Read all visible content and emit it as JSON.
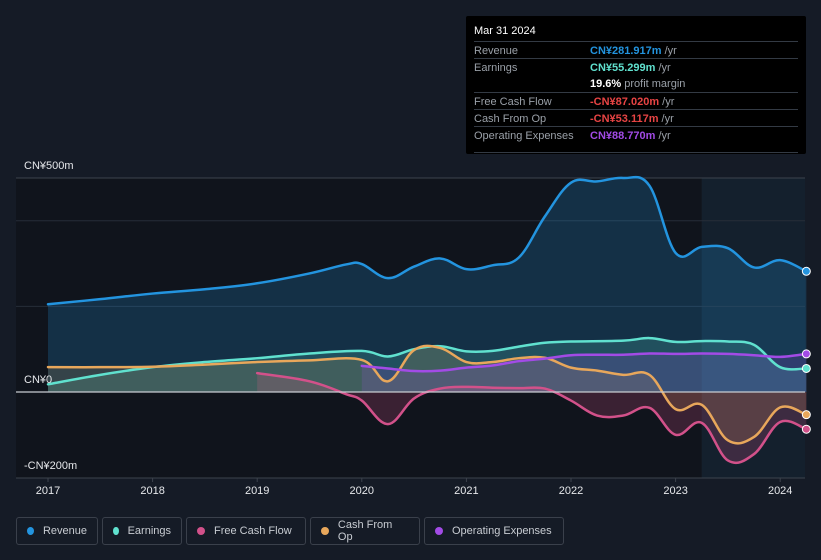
{
  "tooltip": {
    "date": "Mar 31 2024",
    "rows": [
      {
        "label": "Revenue",
        "value": "CN¥281.917m",
        "unit": " /yr",
        "color": "#2394df"
      },
      {
        "label": "Earnings",
        "value": "CN¥55.299m",
        "unit": " /yr",
        "color": "#60e1cf"
      },
      {
        "label": "",
        "value": "19.6%",
        "unit": " profit margin",
        "color": "#ffffff"
      },
      {
        "label": "Free Cash Flow",
        "value": "-CN¥87.020m",
        "unit": " /yr",
        "color": "#e84444"
      },
      {
        "label": "Cash From Op",
        "value": "-CN¥53.117m",
        "unit": " /yr",
        "color": "#e84444"
      },
      {
        "label": "Operating Expenses",
        "value": "CN¥88.770m",
        "unit": " /yr",
        "color": "#a24be6"
      }
    ]
  },
  "chart_data": {
    "type": "area",
    "title": "",
    "xlabel": "",
    "ylabel": "",
    "y_tick_labels": [
      "CN¥500m",
      "CN¥0",
      "-CN¥200m"
    ],
    "x_tick_labels": [
      "2017",
      "2018",
      "2019",
      "2020",
      "2021",
      "2022",
      "2023",
      "2024"
    ],
    "ylim": [
      -200,
      500
    ],
    "xlim": [
      2016.7,
      2024.25
    ],
    "grid": true,
    "legend_position": "bottom-left",
    "highlight_start": 2023.25,
    "series": [
      {
        "name": "Revenue",
        "color": "#2394df",
        "x": [
          2017.0,
          2017.5,
          2018.0,
          2018.5,
          2019.0,
          2019.5,
          2019.85,
          2020.0,
          2020.25,
          2020.5,
          2020.75,
          2021.0,
          2021.25,
          2021.5,
          2021.75,
          2022.0,
          2022.25,
          2022.5,
          2022.75,
          2023.0,
          2023.25,
          2023.5,
          2023.75,
          2024.0,
          2024.25
        ],
        "values": [
          205,
          217,
          230,
          240,
          254,
          277,
          298,
          299,
          266,
          293,
          312,
          287,
          296,
          314,
          410,
          489,
          492,
          500,
          482,
          325,
          339,
          336,
          291,
          308,
          282
        ]
      },
      {
        "name": "Earnings",
        "color": "#60e1cf",
        "x": [
          2017.0,
          2017.5,
          2018.0,
          2018.5,
          2019.0,
          2019.5,
          2020.0,
          2020.25,
          2020.5,
          2020.75,
          2021.0,
          2021.25,
          2021.5,
          2021.75,
          2022.0,
          2022.5,
          2022.75,
          2023.0,
          2023.25,
          2023.5,
          2023.75,
          2024.0,
          2024.25
        ],
        "values": [
          18,
          40,
          58,
          70,
          79,
          90,
          96,
          83,
          100,
          107,
          95,
          96,
          106,
          115,
          118,
          120,
          126,
          117,
          119,
          118,
          110,
          58,
          55
        ]
      },
      {
        "name": "Free Cash Flow",
        "color": "#d2518a",
        "x": [
          2019.0,
          2019.5,
          2019.85,
          2020.0,
          2020.25,
          2020.5,
          2020.75,
          2021.0,
          2021.25,
          2021.5,
          2021.75,
          2022.0,
          2022.25,
          2022.5,
          2022.75,
          2023.0,
          2023.25,
          2023.5,
          2023.75,
          2024.0,
          2024.25
        ],
        "values": [
          44,
          25,
          -5,
          -20,
          -75,
          -15,
          8,
          12,
          10,
          9,
          8,
          -20,
          -55,
          -55,
          -37,
          -100,
          -72,
          -160,
          -145,
          -70,
          -87
        ]
      },
      {
        "name": "Cash From Op",
        "color": "#e8a75b",
        "x": [
          2017.0,
          2017.5,
          2018.0,
          2018.5,
          2019.0,
          2019.5,
          2020.0,
          2020.25,
          2020.5,
          2020.75,
          2021.0,
          2021.25,
          2021.5,
          2021.75,
          2022.0,
          2022.25,
          2022.5,
          2022.75,
          2023.0,
          2023.25,
          2023.5,
          2023.75,
          2024.0,
          2024.25
        ],
        "values": [
          58,
          58,
          59,
          64,
          70,
          74,
          75,
          25,
          98,
          103,
          70,
          70,
          79,
          80,
          57,
          50,
          40,
          40,
          -40,
          -30,
          -113,
          -105,
          -36,
          -53
        ]
      },
      {
        "name": "Operating Expenses",
        "color": "#a24be6",
        "x": [
          2020.0,
          2020.25,
          2020.5,
          2020.75,
          2021.0,
          2021.25,
          2021.5,
          2021.75,
          2022.0,
          2022.25,
          2022.5,
          2022.75,
          2023.0,
          2023.25,
          2023.5,
          2023.75,
          2024.0,
          2024.25
        ],
        "values": [
          61,
          55,
          49,
          50,
          57,
          62,
          72,
          78,
          86,
          87,
          87,
          90,
          89,
          90,
          89,
          86,
          82,
          89
        ]
      }
    ]
  },
  "legend": [
    {
      "label": "Revenue",
      "color": "#2394df"
    },
    {
      "label": "Earnings",
      "color": "#60e1cf"
    },
    {
      "label": "Free Cash Flow",
      "color": "#d2518a"
    },
    {
      "label": "Cash From Op",
      "color": "#e8a75b"
    },
    {
      "label": "Operating Expenses",
      "color": "#a24be6"
    }
  ]
}
